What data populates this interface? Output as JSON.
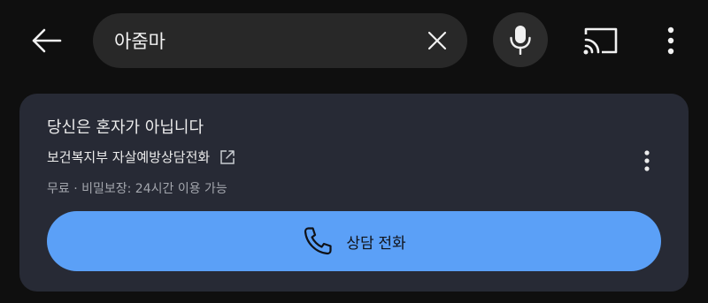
{
  "top_bar": {
    "back_icon": "arrow-left-icon",
    "search": {
      "value": "아줌마",
      "clear_icon": "close-icon"
    },
    "voice_icon": "microphone-icon",
    "cast_icon": "cast-icon",
    "more_icon": "more-vertical-icon"
  },
  "help_card": {
    "title": "당신은 혼자가 아닙니다",
    "provider": "보건복지부 자살예방상담전화",
    "provider_icon": "external-link-icon",
    "details": "무료 · 비밀보장: 24시간 이용 가능",
    "more_icon": "more-vertical-icon",
    "call_button": {
      "label": "상담 전화",
      "icon": "phone-icon"
    },
    "colors": {
      "card_background": "#272a35",
      "button_background": "#5ba0f7"
    }
  }
}
